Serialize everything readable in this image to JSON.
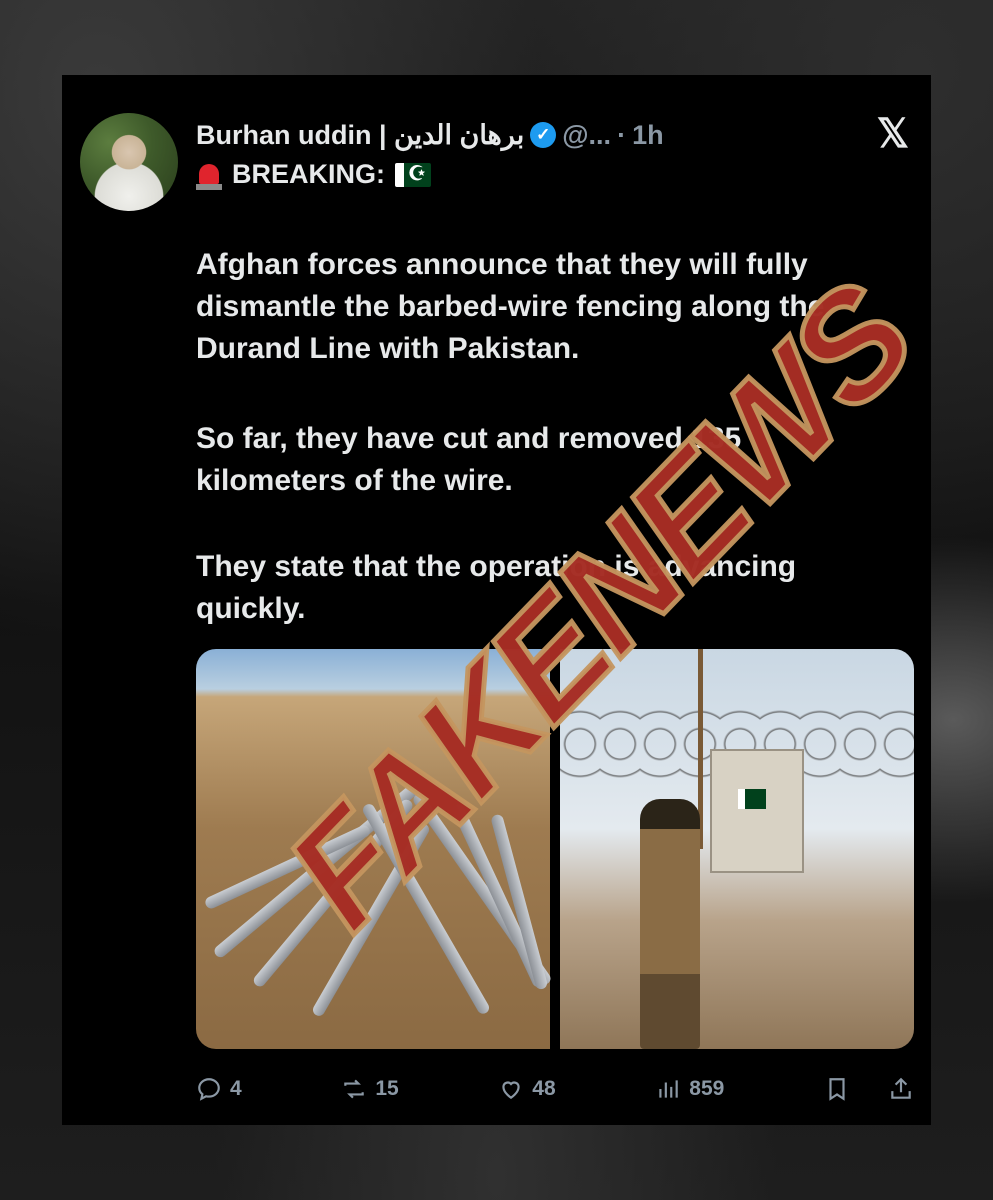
{
  "post": {
    "author_name": "Burhan uddin | برهان الدين",
    "handle": "@...",
    "separator": "·",
    "time": "1h",
    "breaking_label": "BREAKING:",
    "paragraphs": [
      "Afghan forces announce that they will fully dismantle the barbed-wire fencing along the Durand Line with Pakistan.",
      "So far, they have cut and removed 135 kilometers of the wire.",
      "They state that the operation is advancing quickly."
    ],
    "icons": {
      "siren": "rotating-light-icon",
      "flag": "pakistan-flag-icon",
      "verified": "verified-badge-icon",
      "platform": "x-logo-icon"
    }
  },
  "actions": {
    "replies": "4",
    "reposts": "15",
    "likes": "48",
    "views": "859"
  },
  "overlay": {
    "stamp_text": "FAKENEWS"
  },
  "colors": {
    "background": "#000000",
    "text": "#e7e9ea",
    "muted": "#8b98a5",
    "verified": "#1d9bf0",
    "stamp_fill": "#a01919",
    "stamp_outline": "#c4965f"
  }
}
